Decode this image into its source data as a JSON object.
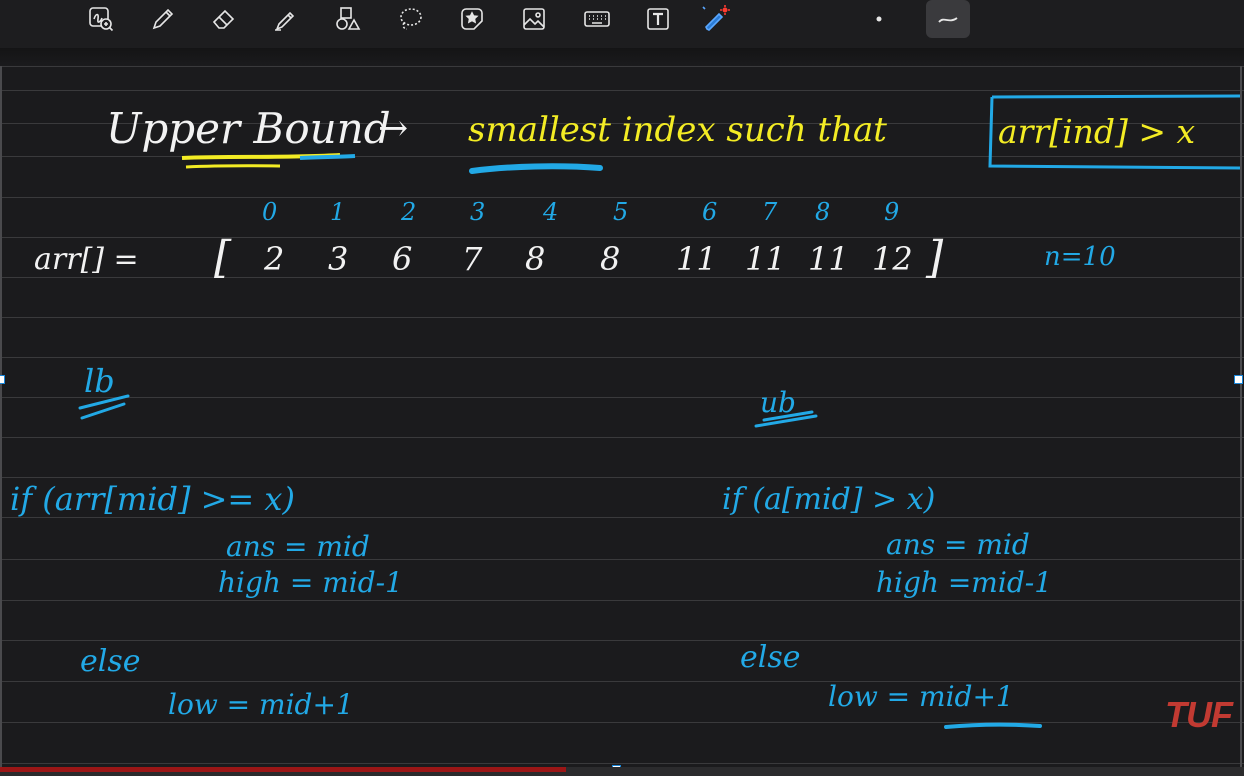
{
  "toolbar": {
    "tools": [
      {
        "name": "zoom-icon"
      },
      {
        "name": "pen-icon"
      },
      {
        "name": "eraser-icon"
      },
      {
        "name": "highlighter-icon"
      },
      {
        "name": "shapes-icon"
      },
      {
        "name": "lasso-icon"
      },
      {
        "name": "sticker-icon"
      },
      {
        "name": "image-icon"
      },
      {
        "name": "keyboard-icon"
      },
      {
        "name": "text-box-icon"
      },
      {
        "name": "laser-pointer-icon"
      },
      {
        "name": "pen-size-dot-icon"
      },
      {
        "name": "pen-stroke-icon"
      }
    ]
  },
  "notes": {
    "title_left": "Upper Bound",
    "arrow": "→",
    "title_mid": "smallest index such that",
    "title_box": "arr[ind] > x",
    "indices": [
      "0",
      "1",
      "2",
      "3",
      "4",
      "5",
      "6",
      "7",
      "8",
      "9"
    ],
    "array_label": "arr[] =",
    "open_bracket": "[",
    "close_bracket": "]",
    "values": [
      "2",
      "3",
      "6",
      "7",
      "8",
      "8",
      "11",
      "11",
      "11",
      "12"
    ],
    "n_label": "n=10",
    "lb_label": "lb",
    "ub_label": "ub",
    "lb_cond": "if (arr[mid] >= x)",
    "lb_ans": "ans = mid",
    "lb_high": "high = mid-1",
    "lb_else": "else",
    "lb_low": "low = mid+1",
    "ub_cond": "if (a[mid] > x)",
    "ub_ans": "ans = mid",
    "ub_high": "high =mid-1",
    "ub_else": "else",
    "ub_low": "low = mid+1"
  },
  "watermark": "TUF",
  "colors": {
    "white_ink": "#f2f2f2",
    "yellow_ink": "#f3ec24",
    "cyan_ink": "#22a9e6",
    "watermark": "#c23a32"
  }
}
